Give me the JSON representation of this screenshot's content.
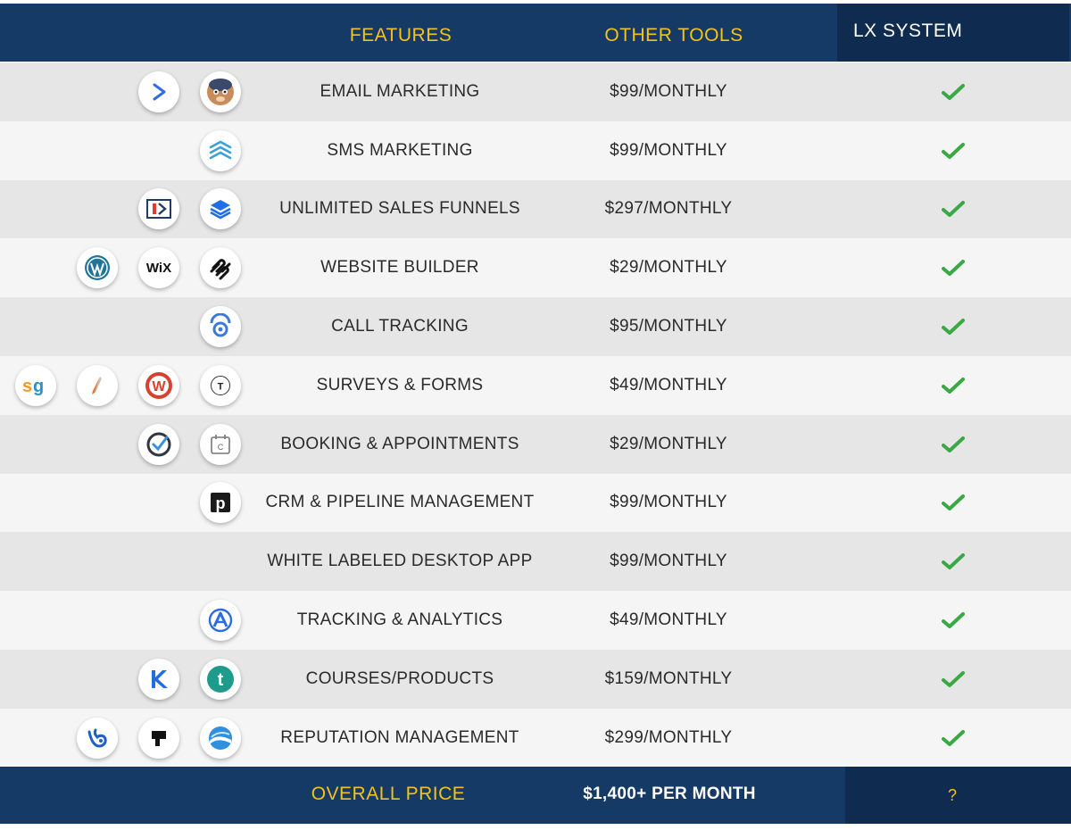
{
  "header": {
    "features": "FEATURES",
    "other_tools": "OTHER TOOLS",
    "lx_system": "LX SYSTEM"
  },
  "rows": [
    {
      "feature": "EMAIL MARKETING",
      "price": "$99/MONTHLY",
      "icons": [
        "activecampaign-icon",
        "mailchimp-icon"
      ]
    },
    {
      "feature": "SMS MARKETING",
      "price": "$99/MONTHLY",
      "icons": [
        "stacked-chevrons-icon"
      ]
    },
    {
      "feature": "UNLIMITED SALES FUNNELS",
      "price": "$297/MONTHLY",
      "icons": [
        "clickfunnels-icon",
        "layers-icon"
      ]
    },
    {
      "feature": "WEBSITE BUILDER",
      "price": "$29/MONTHLY",
      "icons": [
        "wordpress-icon",
        "wix-icon",
        "squarespace-icon"
      ]
    },
    {
      "feature": "CALL TRACKING",
      "price": "$95/MONTHLY",
      "icons": [
        "callrail-icon"
      ]
    },
    {
      "feature": "SURVEYS & FORMS",
      "price": "$49/MONTHLY",
      "icons": [
        "surveygizmo-icon",
        "pen-nib-icon",
        "wufoo-icon",
        "typeform-icon"
      ]
    },
    {
      "feature": "BOOKING & APPOINTMENTS",
      "price": "$29/MONTHLY",
      "icons": [
        "acuity-check-icon",
        "calendly-icon"
      ]
    },
    {
      "feature": "CRM & PIPELINE MANAGEMENT",
      "price": "$99/MONTHLY",
      "icons": [
        "pipedrive-icon"
      ]
    },
    {
      "feature": "WHITE LABELED DESKTOP APP",
      "price": "$99/MONTHLY",
      "icons": []
    },
    {
      "feature": "TRACKING & ANALYTICS",
      "price": "$49/MONTHLY",
      "icons": [
        "analytics-a-icon"
      ]
    },
    {
      "feature": "COURSES/PRODUCTS",
      "price": "$159/MONTHLY",
      "icons": [
        "kajabi-icon",
        "teachable-icon"
      ]
    },
    {
      "feature": "REPUTATION MANAGEMENT",
      "price": "$299/MONTHLY",
      "icons": [
        "birdeye-icon",
        "podium-icon",
        "swell-icon"
      ]
    }
  ],
  "footer": {
    "label": "OVERALL PRICE",
    "total": "$1,400+ PER MONTH",
    "lx_value": "?"
  },
  "colors": {
    "header_bg": "#153a66",
    "lx_bg": "#0f2c50",
    "accent_yellow": "#f5c21a",
    "check_green": "#3aa845",
    "row_dark": "#e6e6e6",
    "row_light": "#f5f5f5"
  }
}
